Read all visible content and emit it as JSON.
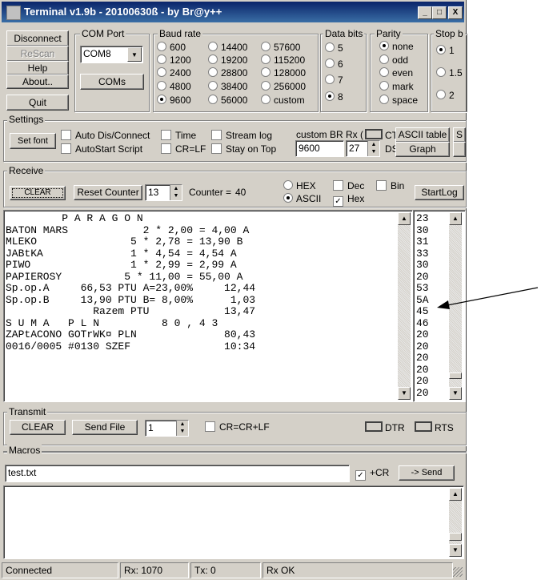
{
  "window": {
    "title": "Terminal v1.9b - 20100630ß - by Br@y++",
    "min": "_",
    "max": "□",
    "close": "X"
  },
  "conn": {
    "disconnect": "Disconnect",
    "rescan": "ReScan",
    "help": "Help",
    "about": "About..",
    "quit": "Quit"
  },
  "com": {
    "label": "COM Port",
    "value": "COM8",
    "coms": "COMs"
  },
  "baud": {
    "label": "Baud rate",
    "options": [
      "600",
      "1200",
      "2400",
      "4800",
      "9600",
      "14400",
      "19200",
      "28800",
      "38400",
      "56000",
      "57600",
      "115200",
      "128000",
      "256000",
      "custom"
    ],
    "selected": "9600"
  },
  "databits": {
    "label": "Data bits",
    "options": [
      "5",
      "6",
      "7",
      "8"
    ],
    "selected": "8"
  },
  "parity": {
    "label": "Parity",
    "options": [
      "none",
      "odd",
      "even",
      "mark",
      "space"
    ],
    "selected": "none"
  },
  "stopbits": {
    "label": "Stop b",
    "options": [
      "1",
      "1.5",
      "2"
    ],
    "selected": "1"
  },
  "settings": {
    "label": "Settings",
    "set_font": "Set font",
    "auto_dis": "Auto Dis/Connect",
    "autostart": "AutoStart Script",
    "time": "Time",
    "crlf": "CR=LF",
    "stream_log": "Stream log",
    "stay_on_top": "Stay on Top",
    "custom_br_label": "custom BR",
    "custom_br_value": "9600",
    "rx_label": "Rx (",
    "rx_value": "27",
    "ct": "CT",
    "ds": "DS",
    "ascii_table": "ASCII table",
    "graph": "Graph",
    "s": "S"
  },
  "receive": {
    "label": "Receive",
    "clear": "CLEAR",
    "reset_counter": "Reset Counter",
    "counter_spin": "13",
    "counter_label": "Counter =",
    "counter_value": "40",
    "hex_label": "HEX",
    "ascii_label": "ASCII",
    "dec_label": "Dec",
    "hex_chk_label": "Hex",
    "bin_label": "Bin",
    "startlog": "StartLog",
    "lines": [
      "         P A R A G O N",
      "BATON MARS            2 * 2,00 = 4,00 A",
      "MLEKO               5 * 2,78 = 13,90 B",
      "JABtKA              1 * 4,54 = 4,54 A",
      "PIWO                1 * 2,99 = 2,99 A",
      "PAPIEROSY          5 * 11,00 = 55,00 A",
      "Sp.op.A     66,53 PTU A=23,00%     12,44",
      "Sp.op.B     13,90 PTU B= 8,00%      1,03",
      "              Razem PTU            13,47",
      "S U M A   P L N          8 0 , 4 3",
      "ZAPtACONO GOTrWK¤ PLN              80,43",
      "0016/0005 #0130 SZEF               10:34"
    ],
    "hex_lines": [
      "23",
      "30",
      "31",
      "33",
      "30",
      "20",
      "53",
      "5A",
      "45",
      "46",
      "20",
      "20",
      "20",
      "20",
      "20",
      "20"
    ]
  },
  "transmit": {
    "label": "Transmit",
    "clear": "CLEAR",
    "send_file": "Send File",
    "repeat": "1",
    "crcrlf": "CR=CR+LF",
    "dtr": "DTR",
    "rts": "RTS"
  },
  "macros": {
    "label": "Macros",
    "input": "test.txt",
    "plus_cr": "+CR",
    "send": "-> Send"
  },
  "status": {
    "connected": "Connected",
    "rx": "Rx: 1070",
    "tx": "Tx: 0",
    "rx_ok": "Rx OK"
  }
}
